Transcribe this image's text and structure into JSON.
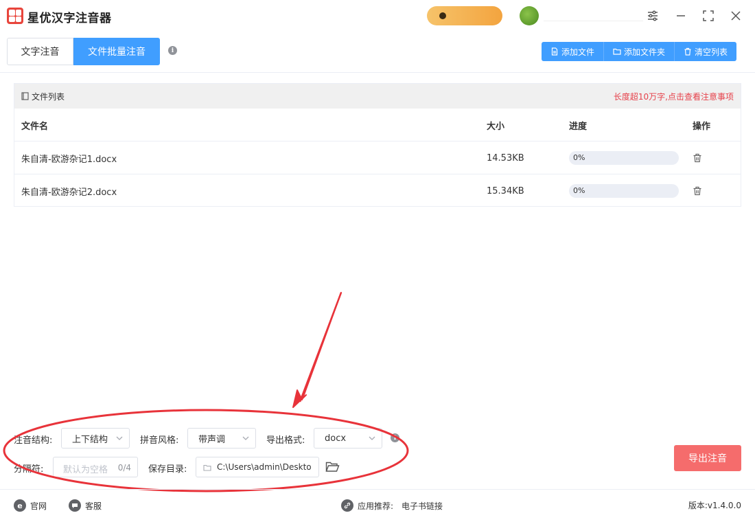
{
  "app": {
    "title": "星优汉字注音器"
  },
  "tabs": [
    {
      "label": "文字注音",
      "active": false
    },
    {
      "label": "文件批量注音",
      "active": true
    }
  ],
  "toolbar": {
    "add_file": "添加文件",
    "add_folder": "添加文件夹",
    "clear_list": "清空列表"
  },
  "file_panel": {
    "title": "文件列表",
    "warning": "长度超10万字,点击查看注意事项",
    "columns": {
      "name": "文件名",
      "size": "大小",
      "progress": "进度",
      "action": "操作"
    },
    "rows": [
      {
        "name": "朱自清-欧游杂记1.docx",
        "size": "14.53KB",
        "progress": 0,
        "progress_text": "0%"
      },
      {
        "name": "朱自清-欧游杂记2.docx",
        "size": "15.34KB",
        "progress": 0,
        "progress_text": "0%"
      }
    ]
  },
  "settings": {
    "structure_label": "注音结构:",
    "structure_value": "上下结构",
    "style_label": "拼音风格:",
    "style_value": "带声调",
    "format_label": "导出格式:",
    "format_value": "docx",
    "separator_label": "分隔符:",
    "separator_placeholder": "默认为空格",
    "separator_count": "0/4",
    "save_dir_label": "保存目录:",
    "save_dir_value": "C:\\Users\\admin\\Deskto"
  },
  "export_button": "导出注音",
  "footer": {
    "website": "官网",
    "support": "客服",
    "recommend_label": "应用推荐:",
    "recommend_link": "电子书链接",
    "version": "版本:v1.4.0.0"
  },
  "colors": {
    "primary": "#409eff",
    "danger": "#f56c6c",
    "warning_text": "#e6414a",
    "annotation": "#e8333a"
  }
}
